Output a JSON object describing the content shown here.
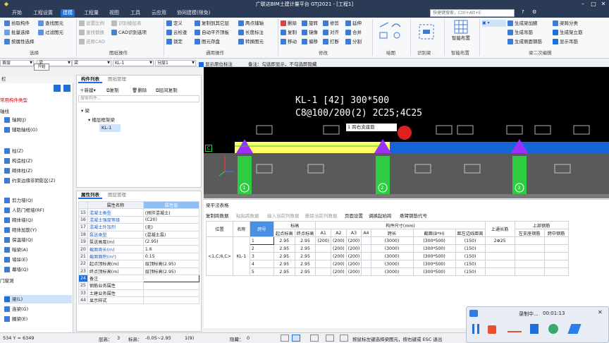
{
  "titlebar": {
    "title": "广联达BIM土建计量平台 GTJ2021 - [工程1]"
  },
  "menu": [
    "开始",
    "工程设置",
    "建模",
    "工程量",
    "视图",
    "工具",
    "云应用",
    "协同建模(限免)"
  ],
  "menu_active": "建模",
  "search": {
    "placeholder": "快捷键搜索，Ctrl+Alt+E"
  },
  "ribbon": {
    "select_group": {
      "items": [
        "拾取构件",
        "批量选择",
        "按属性选择"
      ],
      "label": "选择"
    },
    "drawing_group": {
      "items": [
        "查找图元",
        "过滤图元"
      ],
      "label": ""
    },
    "cad_group": {
      "items": [
        "设置比例",
        "查找替换",
        "还原CAD",
        "识别楼层表",
        "CAD识别选项"
      ],
      "label": "图纸操作"
    },
    "common_group": {
      "items": [
        "定义",
        "云检查",
        "锁定",
        "复制到其它层",
        "自动平齐顶板",
        "图元存盘",
        "两点辅轴",
        "长度标注",
        "转换图元"
      ],
      "label": "通用操作"
    },
    "modify_group": {
      "items": [
        "删除",
        "复制",
        "移动",
        "旋转",
        "镜像",
        "偏移",
        "修剪",
        "对齐",
        "打断",
        "延伸",
        "合并",
        "分割"
      ],
      "label": "修改"
    },
    "draw_label": "绘图",
    "recognize_label": "识别梁",
    "smart_btn": "智能布置",
    "smart_label": "智能布置",
    "beam_group": {
      "items": [
        "生成梁加腋",
        "生成吊筋",
        "生成侧面钢筋",
        "生成架立筋",
        "梁跨分类",
        "显示吊筋",
        "显示吊筋"
      ],
      "label": "梁二次编辑"
    }
  },
  "toolbar": {
    "floor_combo": "首层",
    "type_combo": "梁",
    "name_combo": "梁",
    "comp_combo": "KL-1",
    "layer_combo": "分层1",
    "show_label": "显示原位标注",
    "tip": "备注：勾选即显示，不勾选即隐藏"
  },
  "tooltip": "开始",
  "leftnav": {
    "header": "栏",
    "sections": [
      "常用构件类型",
      "轴线",
      "柱",
      "墙",
      "门窗洞",
      "梁"
    ],
    "items": [
      "轴网(J)",
      "辅助轴线(O)",
      "柱(Z)",
      "构造柱(Z)",
      "砌体柱(Z)",
      "约束边缘非阴影区(Z)",
      "剪力墙(Q)",
      "人防门框墙(RF)",
      "砌体墙(Q)",
      "砌体加筋(Y)",
      "保温墙(Q)",
      "暗梁(A)",
      "墙垛(E)",
      "幕墙(Q)",
      "梁(L)",
      "连梁(G)",
      "圈梁(E)"
    ],
    "selected": "梁(L)"
  },
  "comp_panel": {
    "tabs": [
      "构件列表",
      "图纸管理"
    ],
    "actions": [
      "新建",
      "复制",
      "删除",
      "层间复制"
    ],
    "search_placeholder": "搜索构件...",
    "tree": [
      "梁",
      "楼层框架梁",
      "KL-1"
    ]
  },
  "prop_panel": {
    "tabs": [
      "属性列表",
      "图层管理"
    ],
    "header": [
      "属性名称",
      "属性值"
    ],
    "rows": [
      {
        "no": "15",
        "name": "混凝土类型",
        "value": "(预拌混凝土)",
        "blue": true
      },
      {
        "no": "16",
        "name": "混凝土强度等级",
        "value": "(C20)",
        "blue": true
      },
      {
        "no": "17",
        "name": "混凝土外加剂",
        "value": "(无)",
        "blue": true
      },
      {
        "no": "18",
        "name": "泵送类型",
        "value": "(混凝土泵)",
        "blue": true
      },
      {
        "no": "19",
        "name": "泵送高度(m)",
        "value": "(2.95)",
        "blue": false
      },
      {
        "no": "20",
        "name": "截面周长(m)",
        "value": "1.6",
        "blue": true
      },
      {
        "no": "21",
        "name": "截面面积(m²)",
        "value": "0.15",
        "blue": true
      },
      {
        "no": "22",
        "name": "起点顶标高(m)",
        "value": "层顶标高(2.95)",
        "blue": false
      },
      {
        "no": "23",
        "name": "终点顶标高(m)",
        "value": "层顶标高(2.95)",
        "blue": false
      },
      {
        "no": "24",
        "name": "备注",
        "value": "",
        "blue": false
      },
      {
        "no": "25",
        "name": "钢筋业务属性",
        "value": "",
        "blue": false
      },
      {
        "no": "33",
        "name": "土建业务属性",
        "value": "",
        "blue": false
      },
      {
        "no": "44",
        "name": "显示样式",
        "value": "",
        "blue": false
      }
    ]
  },
  "viewport": {
    "annotation_line1": "KL-1 [42] 300*500",
    "annotation_line2": "C8@100/200(2) 2C25;4C25",
    "span_popup": "1 跨右支座筋",
    "axis_label": "C",
    "axis_numbers": [
      "1",
      "2",
      "3"
    ]
  },
  "beam_panel": {
    "title": "梁平法表格",
    "toolbar": [
      "复制跨数据",
      "粘贴跨数据",
      "输入当前列数据",
      "删除当前列数据",
      "页面设置",
      "调换起始跨",
      "悬臂钢筋代号"
    ],
    "headers_top": [
      "位置",
      "名称",
      "跨号",
      "标高",
      "构件尺寸(mm)",
      "上通长筋",
      "上部钢筋"
    ],
    "headers_sub": [
      "起点标高",
      "终点标高",
      "A1",
      "A2",
      "A3",
      "A4",
      "跨长",
      "截面(B*H)",
      "距左边线距离",
      "左支座钢筋",
      "跨中钢筋"
    ],
    "position": "<1,C;6,C>",
    "name": "KL-1",
    "rows": [
      {
        "span": "1",
        "start": "2.95",
        "end": "2.95",
        "a1": "(200)",
        "a2": "(200)",
        "a3": "(200)",
        "a4": "",
        "length": "(3000)",
        "section": "(300*500)",
        "dist": "(150)",
        "top": "2⊕25"
      },
      {
        "span": "2",
        "start": "2.95",
        "end": "2.95",
        "a1": "",
        "a2": "(200)",
        "a3": "(200)",
        "a4": "",
        "length": "(3000)",
        "section": "(300*500)",
        "dist": "(150)",
        "top": ""
      },
      {
        "span": "3",
        "start": "2.95",
        "end": "2.95",
        "a1": "",
        "a2": "(200)",
        "a3": "(200)",
        "a4": "",
        "length": "(3000)",
        "section": "(300*500)",
        "dist": "(150)",
        "top": ""
      },
      {
        "span": "4",
        "start": "2.95",
        "end": "2.95",
        "a1": "",
        "a2": "(200)",
        "a3": "(200)",
        "a4": "",
        "length": "(3000)",
        "section": "(300*500)",
        "dist": "(150)",
        "top": ""
      },
      {
        "span": "5",
        "start": "2.95",
        "end": "2.95",
        "a1": "",
        "a2": "(200)",
        "a3": "(200)",
        "a4": "",
        "length": "(3000)",
        "section": "(300*500)",
        "dist": "(150)",
        "top": ""
      }
    ]
  },
  "statusbar": {
    "coords": "534 Y = 6349",
    "floor_height": "层高：",
    "floor_height_val": "3",
    "elev": "标高：",
    "elev_val": "-0.05~2.95",
    "count": "1(9)",
    "hidden": "隐藏：",
    "hidden_val": "0",
    "hint": "按鼠标左键选择梁图元，按右键或 ESC 退出"
  },
  "recorder": {
    "status": "录制中...",
    "time": "00:01:13"
  }
}
